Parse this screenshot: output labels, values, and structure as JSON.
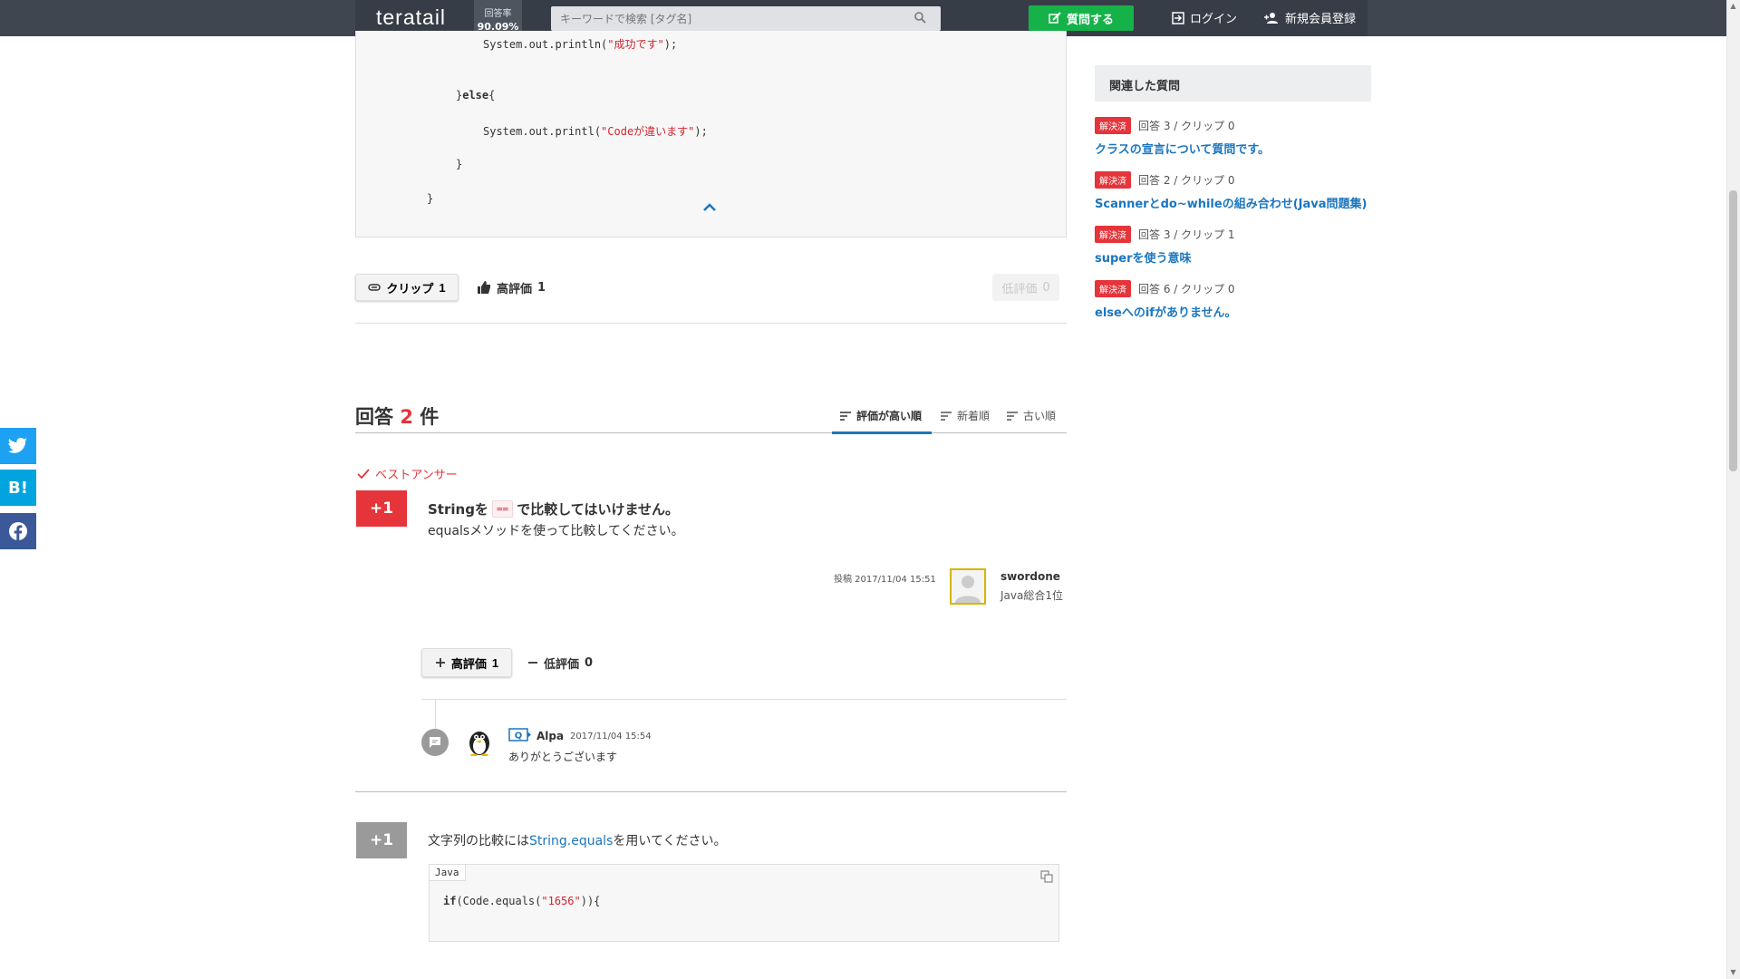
{
  "header": {
    "logo": "teratail",
    "rate_label": "回答率",
    "rate_value": "90.09%",
    "search_placeholder": "キーワードで検索 [タグ名]",
    "ask_label": "質問する",
    "login_label": "ログイン",
    "register_label": "新規会員登録"
  },
  "question": {
    "code_lines": {
      "l1a": "System.out.println(",
      "l1b": "\"成功です\"",
      "l1c": ");",
      "l2a": "}",
      "l2b": "else",
      "l2c": "{",
      "l3a": "System.out.printl(",
      "l3b": "\"Codeが違います\"",
      "l3c": ");",
      "l4": "}",
      "l5": "}"
    },
    "clip_label": "クリップ",
    "clip_count": "1",
    "good_label": "高評価",
    "good_count": "1",
    "bad_label": "低評価",
    "bad_count": "0"
  },
  "answers": {
    "title_prefix": "回答",
    "count": "2",
    "title_suffix": "件",
    "sort": {
      "top": "評価が高い順",
      "new": "新着順",
      "old": "古い順"
    },
    "best_label": "ベストアンサー",
    "a1": {
      "score": "+1",
      "line1_a": "Stringを",
      "line1_code": "==",
      "line1_b": "で比較してはいけません。",
      "line2": "equalsメソッドを使って比較してください。",
      "date": "投稿 2017/11/04 15:51",
      "user": "swordone",
      "rank": "Java総合1位",
      "up_label": "高評価",
      "up_count": "1",
      "down_label": "低評価",
      "down_count": "0",
      "comment": {
        "badge": "Q",
        "user": "Alpa",
        "date": "2017/11/04 15:54",
        "text": "ありがとうございます"
      }
    },
    "a2": {
      "score": "+1",
      "text_a": "文字列の比較には",
      "link": "String.equals",
      "text_b": "を用いてください。",
      "lang": "Java",
      "code_kw": "if",
      "code_a": "(Code.equals(",
      "code_str": "\"1656\"",
      "code_b": ")){"
    }
  },
  "sidebar": {
    "title": "関連した質問",
    "items": [
      {
        "badge": "解決済",
        "meta": "回答 3 / クリップ 0",
        "title": "クラスの宣言について質問です。"
      },
      {
        "badge": "解決済",
        "meta": "回答 2 / クリップ 0",
        "title": "Scannerとdo~whileの組み合わせ(Java問題集)"
      },
      {
        "badge": "解決済",
        "meta": "回答 3 / クリップ 1",
        "title": "superを使う意味"
      },
      {
        "badge": "解決済",
        "meta": "回答 6 / クリップ 0",
        "title": "elseへのifがありません。"
      }
    ]
  },
  "social": {
    "hatena": "B!"
  },
  "colors": {
    "header_bg": "#3f4650",
    "accent_green": "#15b24a",
    "accent_red": "#e5343a",
    "link_blue": "#1b76bf",
    "score_gray": "#9a9a9a"
  }
}
